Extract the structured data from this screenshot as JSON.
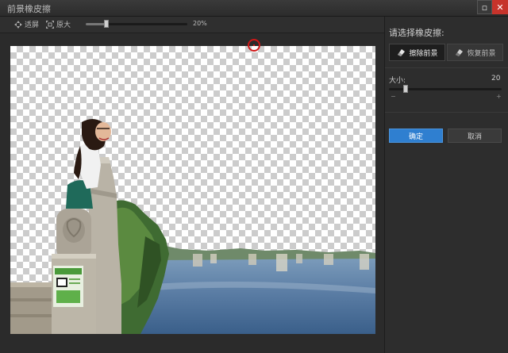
{
  "window": {
    "title": "前景橡皮擦"
  },
  "toolbar": {
    "fit_label": "适屏",
    "actual_label": "原大",
    "zoom_percent": 20,
    "zoom_label": "20%"
  },
  "panel": {
    "title": "请选择橡皮擦:",
    "erase_label": "擦除前景",
    "restore_label": "恢复前景",
    "size_label": "大小:",
    "size_value": "20",
    "size_fraction": 0.15,
    "minus": "−",
    "plus": "+",
    "ok_label": "确定",
    "cancel_label": "取消"
  },
  "icons": {
    "fit": "fit-screen-icon",
    "actual": "actual-size-icon",
    "eraser": "eraser-icon",
    "restore": "restore-eraser-icon",
    "maximize": "maximize-icon",
    "close": "close-icon"
  },
  "colors": {
    "accent": "#2f7fd0",
    "close": "#c6332b",
    "cursor": "#d01818"
  }
}
